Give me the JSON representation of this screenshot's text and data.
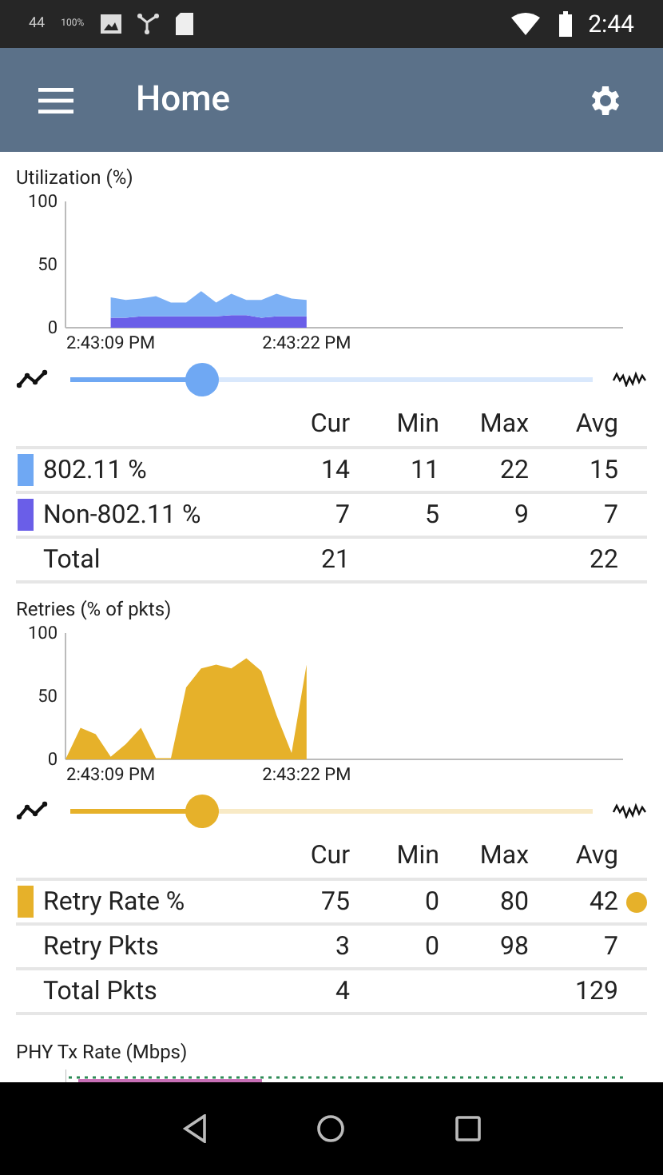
{
  "status_bar": {
    "signal_text": "44",
    "zoom_text": "100%",
    "time": "2:44"
  },
  "app_bar": {
    "title": "Home"
  },
  "panels": [
    {
      "title": "Utilization (%)",
      "chart_data": {
        "type": "area",
        "stacked": true,
        "categories": [
          null,
          null,
          null,
          "2:43:09 PM",
          null,
          null,
          null,
          null,
          null,
          null,
          null,
          null,
          null,
          null,
          null,
          null,
          "2:43:22 PM",
          null,
          null,
          null,
          null,
          null,
          null,
          null,
          null,
          null,
          null,
          null,
          null,
          null,
          null,
          null,
          null,
          null,
          null,
          null,
          null,
          null
        ],
        "ylim": [
          0,
          100
        ],
        "yticks": [
          0,
          50,
          100
        ],
        "series": [
          {
            "color": "#6a5ee8",
            "values": [
              null,
              null,
              null,
              8,
              8,
              9,
              9,
              9,
              9,
              9,
              9,
              10,
              10,
              8,
              9,
              9,
              9,
              null,
              null,
              null,
              null,
              null,
              null,
              null,
              null,
              null,
              null,
              null,
              null,
              null,
              null,
              null,
              null,
              null,
              null,
              null,
              null,
              null
            ]
          },
          {
            "color": "#7cb0f5",
            "values": [
              null,
              null,
              null,
              16,
              14,
              14,
              16,
              11,
              11,
              20,
              11,
              17,
              12,
              14,
              18,
              14,
              13,
              null,
              null,
              null,
              null,
              null,
              null,
              null,
              null,
              null,
              null,
              null,
              null,
              null,
              null,
              null,
              null,
              null,
              null,
              null,
              null,
              null
            ]
          }
        ]
      },
      "slider": {
        "color": "#6fa8f3",
        "level": 0.25
      },
      "columns": [
        "Cur",
        "Min",
        "Max",
        "Avg"
      ],
      "rows": [
        {
          "swatch": true,
          "color": "#6fa8f3",
          "name": "802.11 %",
          "cur": "14",
          "min": "11",
          "max": "22",
          "avg": "15",
          "marker": false
        },
        {
          "swatch": true,
          "color": "#6a5ee8",
          "name": "Non-802.11 %",
          "cur": "7",
          "min": "5",
          "max": "9",
          "avg": "7",
          "marker": false
        },
        {
          "swatch": false,
          "name": "Total",
          "cur": "21",
          "avg": "22",
          "marker": false
        }
      ]
    },
    {
      "title": "Retries (% of pkts)",
      "chart_data": {
        "type": "area",
        "categories": [
          null,
          null,
          null,
          "2:43:09 PM",
          null,
          null,
          null,
          null,
          null,
          null,
          null,
          null,
          null,
          null,
          null,
          null,
          "2:43:22 PM",
          null,
          null,
          null,
          null,
          null,
          null,
          null,
          null,
          null,
          null,
          null,
          null,
          null,
          null,
          null,
          null,
          null,
          null,
          null,
          null,
          null
        ],
        "ylim": [
          0,
          100
        ],
        "yticks": [
          0,
          50,
          100
        ],
        "series": [
          {
            "color": "#e6b12a",
            "values": [
              0,
              25,
              20,
              2,
              12,
              25,
              1,
              1,
              57,
              72,
              75,
              72,
              80,
              70,
              35,
              5,
              75,
              null,
              null,
              null,
              null,
              null,
              null,
              null,
              null,
              null,
              null,
              null,
              null,
              null,
              null,
              null,
              null,
              null,
              null,
              null,
              null,
              null
            ]
          }
        ]
      },
      "slider": {
        "color": "#e6b12a",
        "level": 0.25
      },
      "columns": [
        "Cur",
        "Min",
        "Max",
        "Avg"
      ],
      "rows": [
        {
          "swatch": true,
          "color": "#e6b12a",
          "name": "Retry Rate %",
          "cur": "75",
          "min": "0",
          "max": "80",
          "avg": "42",
          "marker": true
        },
        {
          "swatch": false,
          "name": "Retry Pkts",
          "cur": "3",
          "min": "0",
          "max": "98",
          "avg": "7",
          "marker": false
        },
        {
          "swatch": false,
          "name": "Total Pkts",
          "cur": "4",
          "avg": "129",
          "marker": false
        }
      ]
    }
  ],
  "next_panel": {
    "title": "PHY Tx Rate (Mbps)"
  }
}
